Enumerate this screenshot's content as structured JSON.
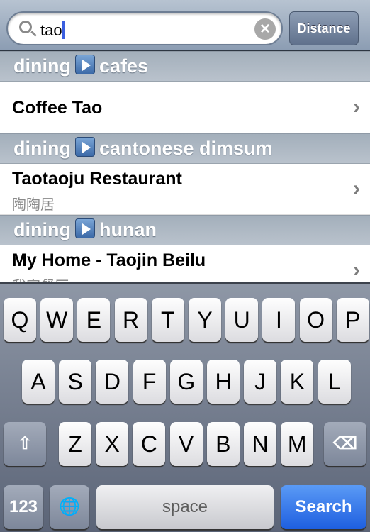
{
  "search": {
    "query": "tao",
    "button": "Distance",
    "clear_icon": "clear-icon",
    "search_icon": "magnifier-icon"
  },
  "sections": [
    {
      "category": "dining",
      "subcategory": "cafes",
      "items": [
        {
          "title": "Coffee Tao",
          "subtitle": ""
        }
      ]
    },
    {
      "category": "dining",
      "subcategory": "cantonese dimsum",
      "items": [
        {
          "title": "Taotaoju Restaurant",
          "subtitle": "陶陶居"
        }
      ]
    },
    {
      "category": "dining",
      "subcategory": "hunan",
      "items": [
        {
          "title": "My Home - Taojin Beilu",
          "subtitle": "我家餐厅"
        }
      ]
    }
  ],
  "keyboard": {
    "row1": [
      "Q",
      "W",
      "E",
      "R",
      "T",
      "Y",
      "U",
      "I",
      "O",
      "P"
    ],
    "row2": [
      "A",
      "S",
      "D",
      "F",
      "G",
      "H",
      "J",
      "K",
      "L"
    ],
    "row3": [
      "Z",
      "X",
      "C",
      "V",
      "B",
      "N",
      "M"
    ],
    "numbers": "123",
    "space": "space",
    "search": "Search",
    "accent": "#1e5fe0"
  }
}
